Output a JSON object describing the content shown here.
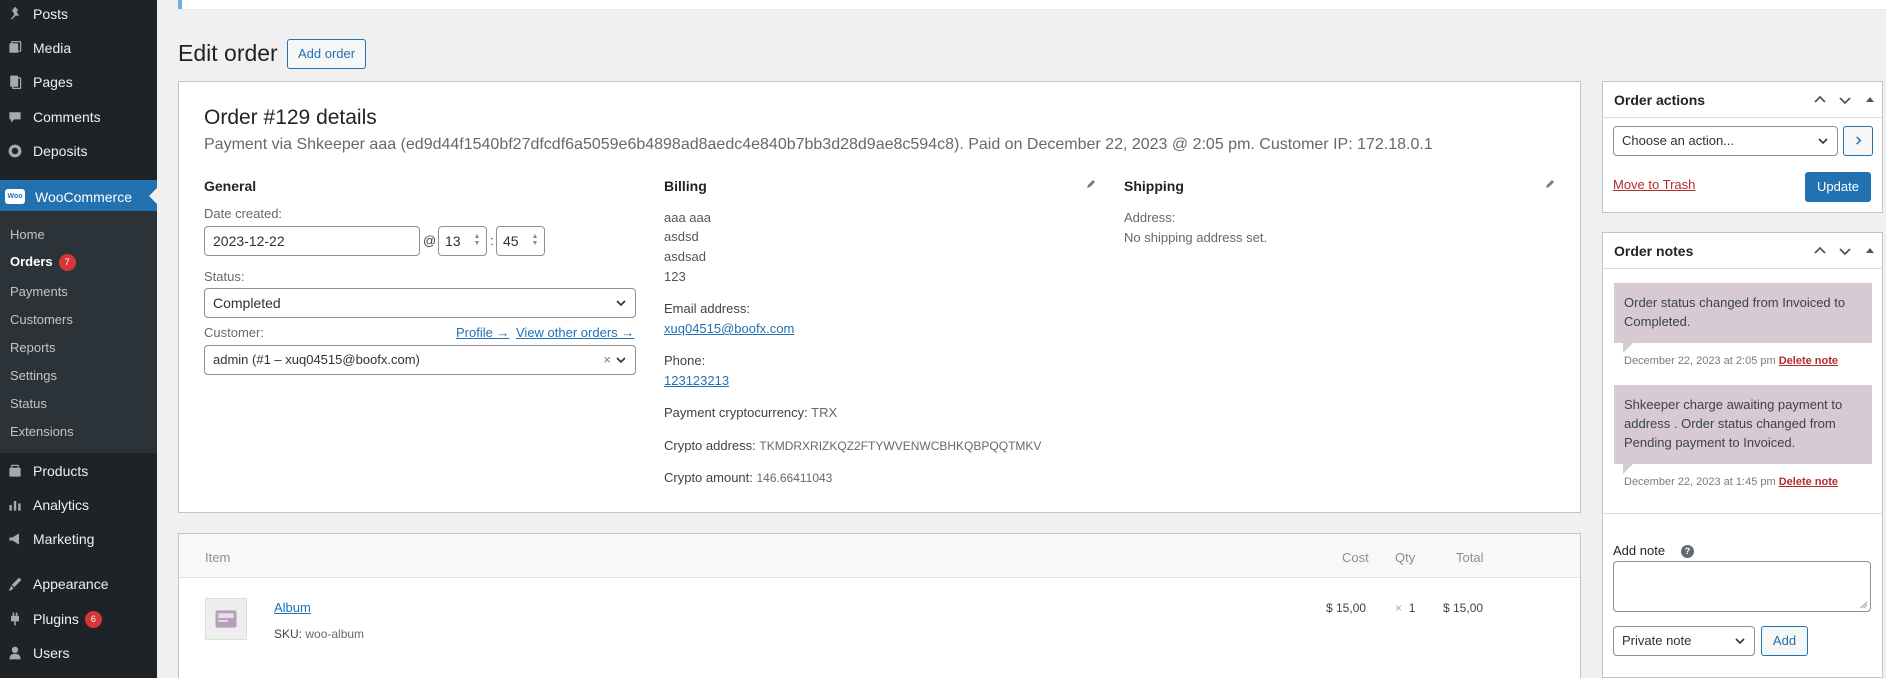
{
  "sidebar": {
    "menu": [
      {
        "label": "Posts",
        "icon": "pushpin-icon"
      },
      {
        "label": "Media",
        "icon": "media-icon"
      },
      {
        "label": "Pages",
        "icon": "pages-icon"
      },
      {
        "label": "Comments",
        "icon": "comments-icon"
      },
      {
        "label": "Deposits",
        "icon": "deposits-icon"
      },
      {
        "label": "WooCommerce",
        "icon": "woocommerce-icon"
      },
      {
        "label": "Products",
        "icon": "products-icon"
      },
      {
        "label": "Analytics",
        "icon": "analytics-icon"
      },
      {
        "label": "Marketing",
        "icon": "megaphone-icon"
      },
      {
        "label": "Appearance",
        "icon": "paintbrush-icon"
      },
      {
        "label": "Plugins",
        "icon": "plugin-icon",
        "badge": "6"
      },
      {
        "label": "Users",
        "icon": "users-icon"
      }
    ],
    "woo_logo_text": "Woo",
    "submenu": [
      {
        "label": "Home"
      },
      {
        "label": "Orders",
        "badge": "7"
      },
      {
        "label": "Payments"
      },
      {
        "label": "Customers"
      },
      {
        "label": "Reports"
      },
      {
        "label": "Settings"
      },
      {
        "label": "Status"
      },
      {
        "label": "Extensions"
      }
    ]
  },
  "header": {
    "title": "Edit order",
    "add_button": "Add order"
  },
  "order": {
    "heading": "Order #129 details",
    "meta": "Payment via Shkeeper aaa (ed9d44f1540bf27dfcdf6a5059e6b4898ad8aedc4e840b7bb3d28d9ae8c594c8). Paid on December 22, 2023 @ 2:05 pm. Customer IP: 172.18.0.1",
    "general": {
      "title": "General",
      "date_label": "Date created:",
      "date_value": "2023-12-22",
      "at": "@",
      "colon": ":",
      "hour": "13",
      "minute": "45",
      "status_label": "Status:",
      "status_value": "Completed",
      "customer_label": "Customer:",
      "profile_link": "Profile →",
      "other_orders_link": "View other orders →",
      "customer_value": "admin (#1 – xuq04515@boofx.com)",
      "clear_mark": "×"
    },
    "billing": {
      "title": "Billing",
      "address_lines": [
        "aaa aaa",
        "asdsd",
        "asdsad",
        "123"
      ],
      "email_label": "Email address:",
      "email": "xuq04515@boofx.com",
      "phone_label": "Phone:",
      "phone": "123123213",
      "crypto_currency_label": "Payment cryptocurrency:",
      "crypto_currency": "TRX",
      "crypto_address_label": "Crypto address:",
      "crypto_address": "TKMDRXRIZKQZ2FTYWVENWCBHKQBPQQTMKV",
      "crypto_amount_label": "Crypto amount:",
      "crypto_amount": "146.66411043"
    },
    "shipping": {
      "title": "Shipping",
      "address_label": "Address:",
      "address_value": "No shipping address set."
    }
  },
  "items": {
    "headers": {
      "item": "Item",
      "cost": "Cost",
      "qty": "Qty",
      "total": "Total"
    },
    "rows": [
      {
        "name": "Album",
        "sku_label": "SKU:",
        "sku": "woo-album",
        "cost": "$ 15,00",
        "qty_mark": "×",
        "qty": "1",
        "total": "$ 15,00"
      }
    ]
  },
  "order_actions": {
    "title": "Order actions",
    "select_value": "Choose an action...",
    "trash_link": "Move to Trash",
    "update_button": "Update"
  },
  "order_notes": {
    "title": "Order notes",
    "notes": [
      {
        "text": "Order status changed from Invoiced to Completed.",
        "date": "December 22, 2023 at 2:05 pm",
        "delete": "Delete note"
      },
      {
        "text": "Shkeeper charge awaiting payment to address . Order status changed from Pending payment to Invoiced.",
        "date": "December 22, 2023 at 1:45 pm",
        "delete": "Delete note"
      }
    ],
    "add_note_label": "Add note",
    "help_mark": "?",
    "note_type": "Private note",
    "add_button": "Add"
  },
  "colors": {
    "primary": "#2271b1",
    "sidebar": "#1d2327",
    "badge": "#d63638",
    "note": "#d7cad2"
  }
}
